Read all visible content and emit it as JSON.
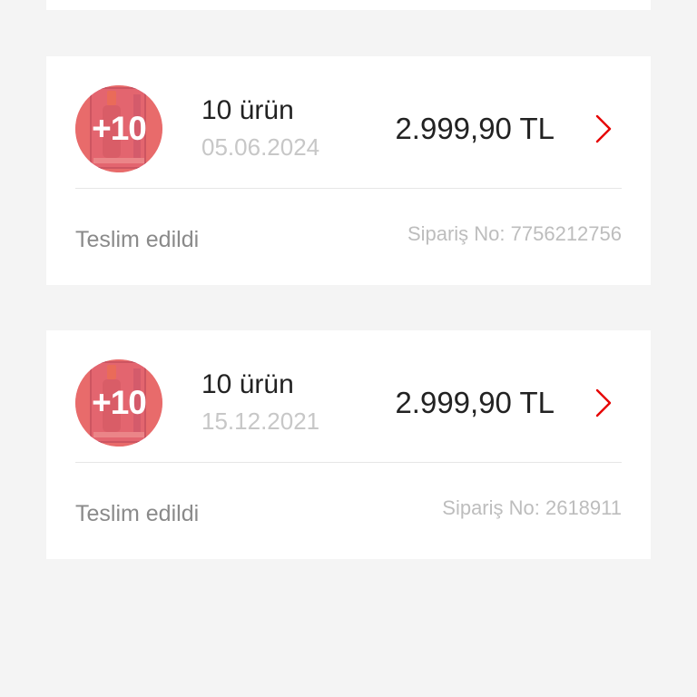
{
  "colors": {
    "background": "#f4f4f4",
    "card": "#ffffff",
    "accent_red": "#e60000",
    "thumb_overlay": "#e86b6b"
  },
  "orders": [
    {
      "thumb_badge": "+10",
      "item_count": "10 ürün",
      "date": "05.06.2024",
      "price": "2.999,90 TL",
      "status": "Teslim edildi",
      "order_no": "Sipariş No: 7756212756",
      "chevron_icon": "chevron-right-icon"
    },
    {
      "thumb_badge": "+10",
      "item_count": "10 ürün",
      "date": "15.12.2021",
      "price": "2.999,90 TL",
      "status": "Teslim edildi",
      "order_no": "Sipariş No: 2618911",
      "chevron_icon": "chevron-right-icon"
    }
  ]
}
